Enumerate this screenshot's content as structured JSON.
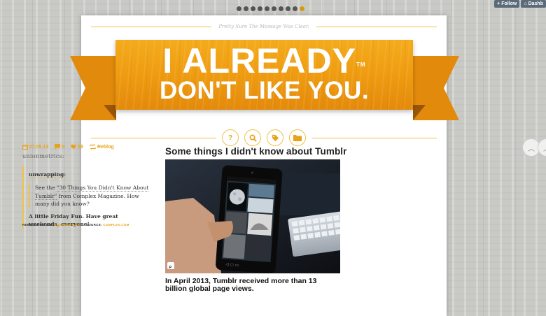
{
  "tumblr": {
    "follow_label": "Follow",
    "dashboard_label": "Dashb"
  },
  "site": {
    "tagline": "Pretty Sure The Message Was Clear.",
    "title_line1": "I ALREADY",
    "tm": "TM",
    "title_line2": "DON'T LIKE YOU."
  },
  "nav": {
    "icons": [
      {
        "name": "question-icon",
        "glyph": "?"
      },
      {
        "name": "search-icon",
        "glyph": "⚲"
      },
      {
        "name": "tag-icon",
        "glyph": "◆"
      },
      {
        "name": "folder-icon",
        "glyph": "▬"
      }
    ]
  },
  "post_left": {
    "date": "07.05.13",
    "comments": "0",
    "likes": "55",
    "reblog_label": "Reblog",
    "username": "unionmetrics:",
    "quote_user": "unwrapping:",
    "quote_inner": {
      "pre": "See the ",
      "link": "\"30 Things You Didn't Know About Tumblr\"",
      "post": " from Complex Magazine. How many did you know?"
    },
    "body": "A little Friday Fun. Have great weekends, everyone!",
    "reblogged_via_label": "REBLOGGED VIA:",
    "reblogged_via": "UNIONMETRICS",
    "source_label": "SOURCE:",
    "source": "COMPLEX.COM"
  },
  "post_right": {
    "title": "Some things I didn't know about Tumblr",
    "text": "In April 2013, Tumblr received more than 13 billion global page views."
  },
  "colors": {
    "accent": "#e7a418",
    "banner": "#ee9a10"
  }
}
